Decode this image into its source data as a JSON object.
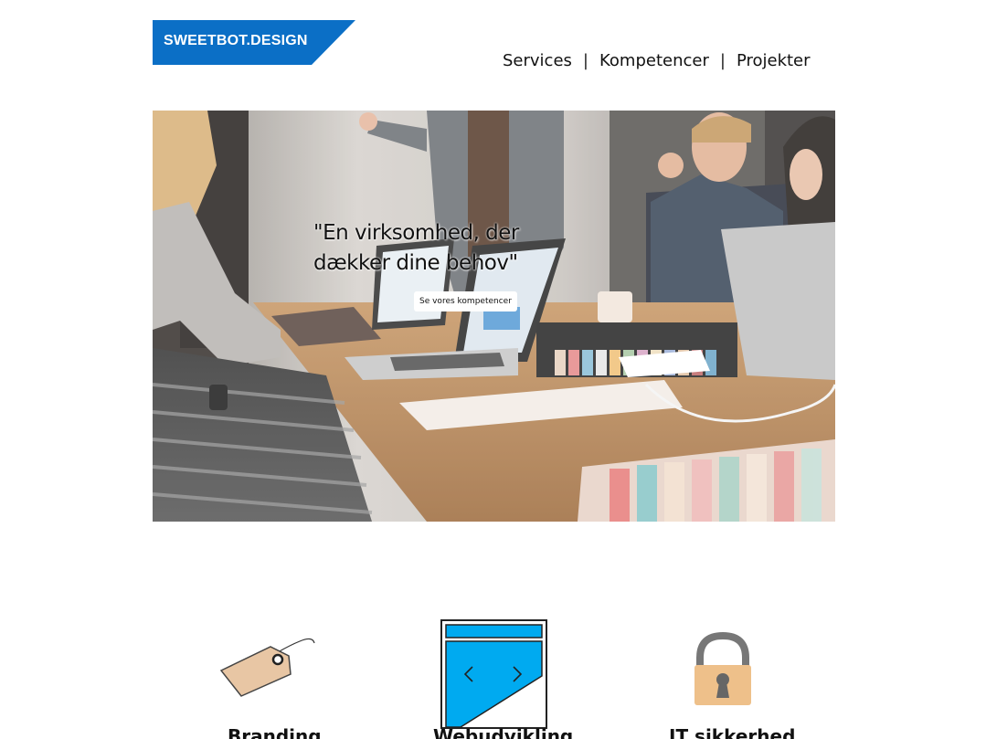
{
  "logo": {
    "text": "SWEETBOT.DESIGN",
    "color": "#0b6fc6"
  },
  "nav": {
    "items": [
      {
        "label": "Services"
      },
      {
        "label": "Kompetencer"
      },
      {
        "label": "Projekter"
      }
    ],
    "separator": "|"
  },
  "hero": {
    "title_line1": "\"En virksomhed, der",
    "title_line2": "dækker dine behov\"",
    "button_label": "Se vores kompetencer"
  },
  "services": [
    {
      "title": "Branding",
      "icon": "price-tag-icon"
    },
    {
      "title": "Webudvikling",
      "icon": "web-window-icon"
    },
    {
      "title": "IT sikkerhed",
      "icon": "padlock-icon"
    }
  ],
  "colors": {
    "brand_blue": "#0b6fc6",
    "web_icon_blue": "#00aaf0",
    "tag_beige": "#e8c6a4",
    "lock_body": "#eec08a",
    "lock_shackle": "#777777"
  }
}
